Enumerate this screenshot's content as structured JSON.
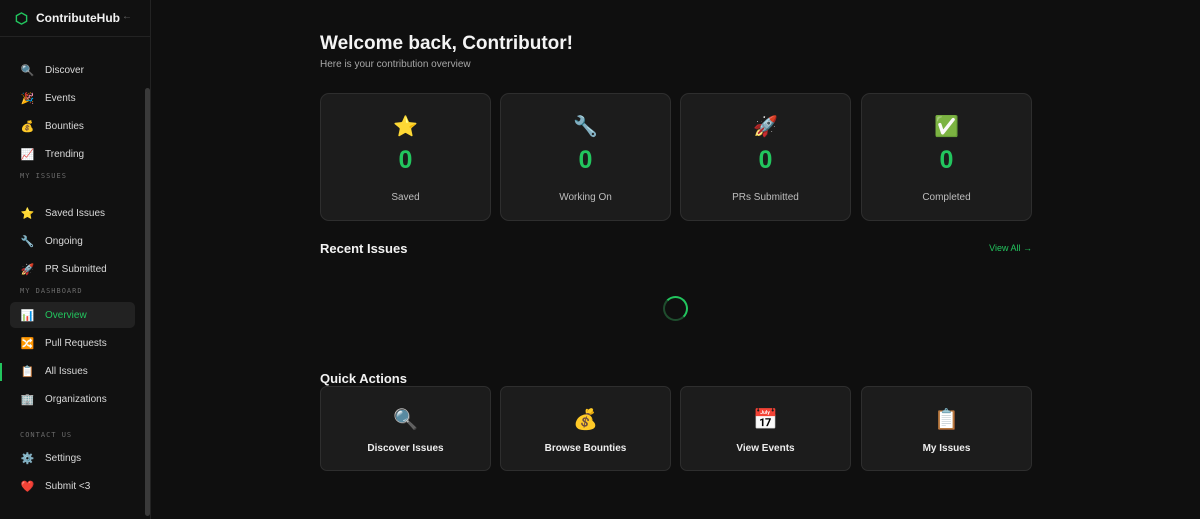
{
  "app": {
    "name": "ContributeHub",
    "collapse_icon": "arrow-left-icon",
    "accent": "#22c55e"
  },
  "sidebar": {
    "main_items": [
      {
        "label": "Discover",
        "icon": "🔍",
        "icon_name": "magnifier-icon"
      },
      {
        "label": "Events",
        "icon": "🎉",
        "icon_name": "party-popper-icon"
      },
      {
        "label": "Bounties",
        "icon": "💰",
        "icon_name": "money-bag-icon"
      },
      {
        "label": "Trending",
        "icon": "📈",
        "icon_name": "trend-chart-icon"
      }
    ],
    "sections": {
      "my_issues": "MY ISSUES",
      "my_dashboard": "MY DASHBOARD",
      "contact_us": "CONTACT US"
    },
    "my_issues_items": [
      {
        "label": "Saved Issues",
        "icon": "⭐",
        "icon_name": "star-icon"
      },
      {
        "label": "Ongoing",
        "icon": "🔧",
        "icon_name": "wrench-icon"
      },
      {
        "label": "PR Submitted",
        "icon": "🚀",
        "icon_name": "rocket-icon"
      }
    ],
    "dashboard_items": [
      {
        "label": "Overview",
        "icon": "📊",
        "icon_name": "bar-chart-icon",
        "active": true
      },
      {
        "label": "Pull Requests",
        "icon": "🔀",
        "icon_name": "shuffle-icon"
      },
      {
        "label": "All Issues",
        "icon": "📋",
        "icon_name": "clipboard-icon"
      },
      {
        "label": "Organizations",
        "icon": "🏢",
        "icon_name": "office-building-icon"
      }
    ],
    "contact_items": [
      {
        "label": "Settings",
        "icon": "⚙️",
        "icon_name": "gear-icon"
      },
      {
        "label": "Submit <3",
        "icon": "❤️",
        "icon_name": "heart-icon"
      }
    ]
  },
  "main": {
    "welcome": "Welcome back, Contributor!",
    "subtitle": "Here is your contribution overview",
    "stats": [
      {
        "icon": "⭐",
        "icon_name": "star-icon",
        "value": "0",
        "label": "Saved"
      },
      {
        "icon": "🔧",
        "icon_name": "wrench-icon",
        "value": "0",
        "label": "Working On"
      },
      {
        "icon": "🚀",
        "icon_name": "rocket-icon",
        "value": "0",
        "label": "PRs Submitted"
      },
      {
        "icon": "✅",
        "icon_name": "check-mark-icon",
        "value": "0",
        "label": "Completed"
      }
    ],
    "recent_issues": {
      "title": "Recent Issues",
      "view_all": "View All →"
    },
    "quick_actions": {
      "title": "Quick Actions",
      "items": [
        {
          "icon": "🔍",
          "icon_name": "magnifier-icon",
          "label": "Discover Issues"
        },
        {
          "icon": "💰",
          "icon_name": "money-bag-icon",
          "label": "Browse Bounties"
        },
        {
          "icon": "📅",
          "icon_name": "calendar-icon",
          "label": "View Events"
        },
        {
          "icon": "📋",
          "icon_name": "clipboard-icon",
          "label": "My Issues"
        }
      ]
    }
  }
}
